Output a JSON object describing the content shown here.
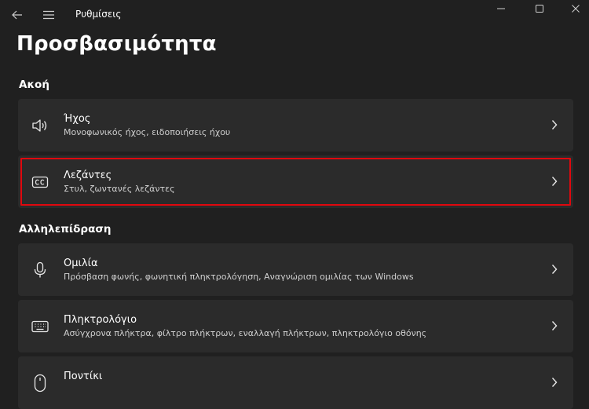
{
  "window": {
    "app_title": "Ρυθμίσεις"
  },
  "page": {
    "title": "Προσβασιμότητα"
  },
  "sections": [
    {
      "title": "Ακοή",
      "items": [
        {
          "title": "Ήχος",
          "subtitle": "Μονοφωνικός ήχος, ειδοποιήσεις ήχου",
          "icon": "speaker-icon"
        },
        {
          "title": "Λεζάντες",
          "subtitle": "Στυλ, ζωντανές λεζάντες",
          "icon": "captions-icon",
          "highlighted": true
        }
      ]
    },
    {
      "title": "Αλληλεπίδραση",
      "items": [
        {
          "title": "Ομιλία",
          "subtitle": "Πρόσβαση φωνής, φωνητική πληκτρολόγηση, Αναγνώριση ομιλίας των Windows",
          "icon": "microphone-icon"
        },
        {
          "title": "Πληκτρολόγιο",
          "subtitle": "Ασύγχρονα πλήκτρα, φίλτρο πλήκτρων, εναλλαγή πλήκτρων, πληκτρολόγιο οθόνης",
          "icon": "keyboard-icon"
        },
        {
          "title": "Ποντίκι",
          "subtitle": "",
          "icon": "mouse-icon"
        }
      ]
    }
  ],
  "colors": {
    "background": "#202020",
    "card": "#2b2b2b",
    "highlight_border": "#e0080e"
  }
}
